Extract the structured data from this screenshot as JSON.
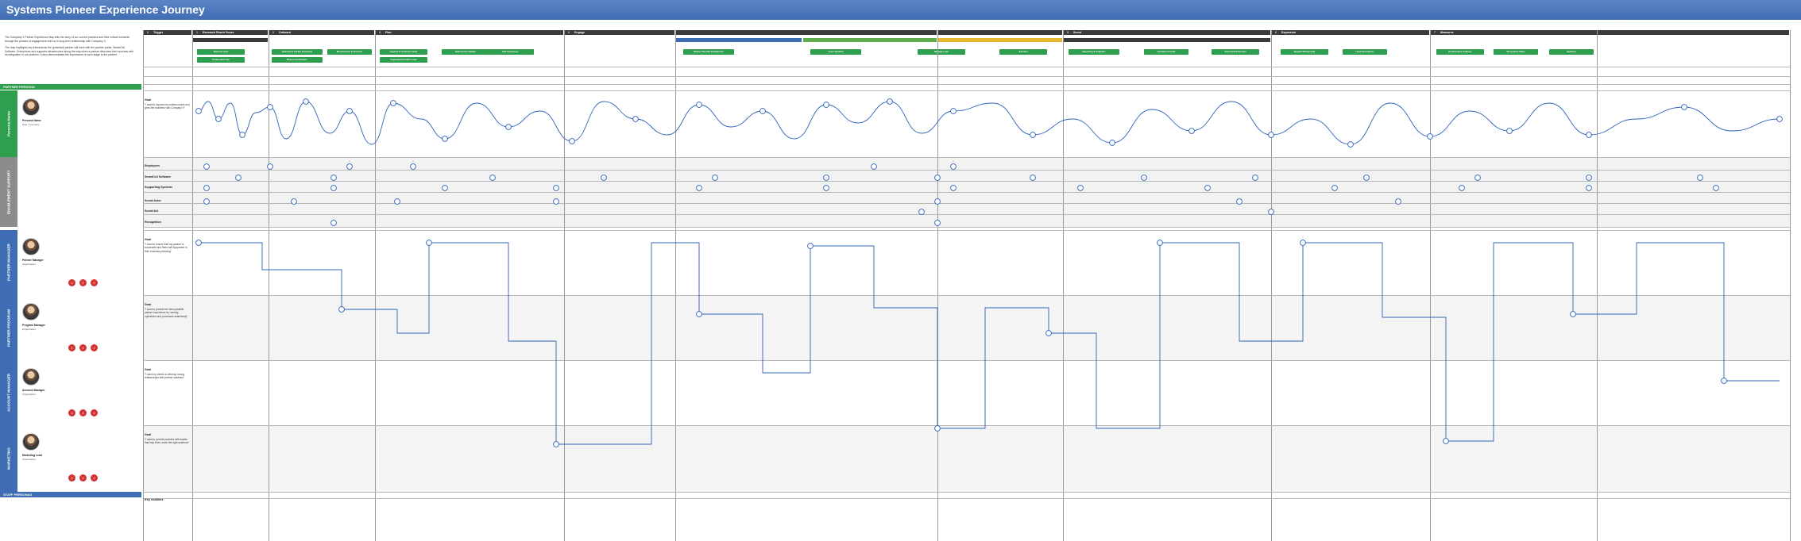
{
  "title": "Systems Pioneer Experience Journey",
  "intro": [
    "The Company X Partner Experience Map tells the story of our current partners and their critical moments through the phases of engagement with us in long-term relationship with Company X.",
    "The map highlights key interactions the (potential) partner will have with the partner portal, SmartCell Software, Enterprises and supports infrastructure along the way when a partner discovers their success with its integration in our platform. It also demonstrates the importance of each stage to the partner."
  ],
  "stages": [
    {
      "num": "0",
      "label": "Trigger"
    },
    {
      "num": "1",
      "label": "Research Reach Fuses"
    },
    {
      "num": "2",
      "label": "Onboard"
    },
    {
      "num": "3",
      "label": "Plan"
    },
    {
      "num": "4",
      "label": "Engage"
    },
    {
      "num": "",
      "label": ""
    },
    {
      "num": "",
      "label": ""
    },
    {
      "num": "5",
      "label": "Scout"
    },
    {
      "num": "6",
      "label": "Expansion"
    },
    {
      "num": "7",
      "label": "Measures"
    }
  ],
  "activities": [
    "Discover area",
    "Understand role",
    "Onboard & Certify & Educate",
    "Monetization & Services",
    "Reach out Partners",
    "Capture & Contract Leads",
    "Submission Guides",
    "Add Customers",
    "Implement Product Lead",
    "Partner Specific Enablement",
    "Learn Solution",
    "Manage Lead",
    "Sell Test",
    "Reporting & Analytics",
    "Continue Growth",
    "Track Sell Outcomes",
    "Expand Partnership",
    "Lead Generations",
    "Performance Analysis",
    "Ecosystem Value",
    "Optimize"
  ],
  "bands": {
    "partner_persona": "PARTNER PERSONA",
    "enablement": "ENABLEMENT SUPPORT",
    "staff_persona": "STAFF PERSONAS",
    "partner_manager": "PARTNER MANAGER",
    "partner_program": "PARTNER PROGRAM",
    "account_manager": "ACCOUNT MANAGER",
    "marketing": "MARKETING"
  },
  "personas": [
    {
      "name": "Persona Name",
      "role": "Role / Company",
      "goal_title": "Goal",
      "goal": "\"I want to expand my solution reach and grow the business with Company X\""
    },
    {
      "name": "Partner Manager",
      "role": "Organization",
      "goal_title": "Goal",
      "goal": "\"I want to ensure that my partner is successful and feels well supported in their business planning\""
    },
    {
      "name": "Program Manager",
      "role": "Organization",
      "goal_title": "Goal",
      "goal": "\"I want to provide the best possible partner experience by running operations and processes seamlessly\""
    },
    {
      "name": "Account Manager",
      "role": "Organization",
      "goal_title": "Goal",
      "goal": "\"I want my clients to develop strong relationships with partner solutions\""
    },
    {
      "name": "Marketing Lead",
      "role": "Organization",
      "goal_title": "Goal",
      "goal": "\"I want to provide partners with assets that help them reach the right audience\""
    }
  ],
  "touchpoints": [
    "Employees",
    "SmartCell Software",
    "Supporting Systems",
    "Social Actor",
    "Social Act",
    "Recognition"
  ],
  "bottom": {
    "key_enablers": "Key enablers"
  },
  "colors": {
    "header": "#3f6db3",
    "stage": "#3b3b3b",
    "activity": "#2e9e4f",
    "persona_band": "#2e9e4f",
    "enablement_band": "#8c8c8c",
    "staff_band": "#3f6db3",
    "flow": "#2e63b8",
    "emotion": "#d33333",
    "sub_blue": "#3f6db3",
    "sub_green": "#5fae4b",
    "sub_yellow": "#e8b630"
  }
}
